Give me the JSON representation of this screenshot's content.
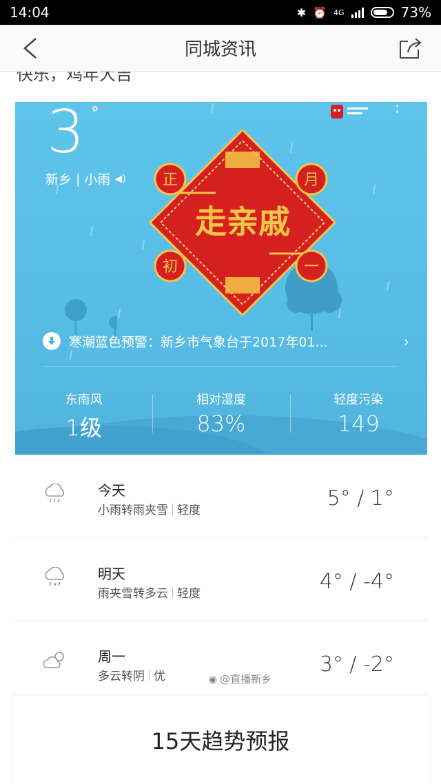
{
  "status_bar": {
    "time": "14:04",
    "network": "4G",
    "battery": "73%"
  },
  "header": {
    "title": "同城资讯"
  },
  "peek_text": "快乐，鸡年大吉",
  "weather": {
    "temperature": "3",
    "degree": "°",
    "city": "新乡",
    "condition": "小雨",
    "ornament": {
      "main": "走亲戚",
      "corners": [
        "正",
        "月",
        "初",
        "一"
      ]
    },
    "alert": "寒潮蓝色预警：新乡市气象台于2017年01...",
    "stats": [
      {
        "label": "东南风",
        "value": "1级"
      },
      {
        "label": "相对湿度",
        "value": "83%"
      },
      {
        "label": "轻度污染",
        "value": "149"
      }
    ]
  },
  "forecast": [
    {
      "day": "今天",
      "desc": "小雨转雨夹雪",
      "aqi": "轻度",
      "range": "5° / 1°",
      "icon": "rain-cloud-icon"
    },
    {
      "day": "明天",
      "desc": "雨夹雪转多云",
      "aqi": "轻度",
      "range": "4° / -4°",
      "icon": "sleet-cloud-icon"
    },
    {
      "day": "周一",
      "desc": "多云转阴",
      "aqi": "优",
      "range": "3° / -2°",
      "icon": "partly-cloudy-icon"
    }
  ],
  "watermark": "@直播新乡",
  "trend_button": "15天趋势预报",
  "colors": {
    "card": "#5fc4ea",
    "ornament_red": "#d62020",
    "gold": "#f3c647"
  }
}
